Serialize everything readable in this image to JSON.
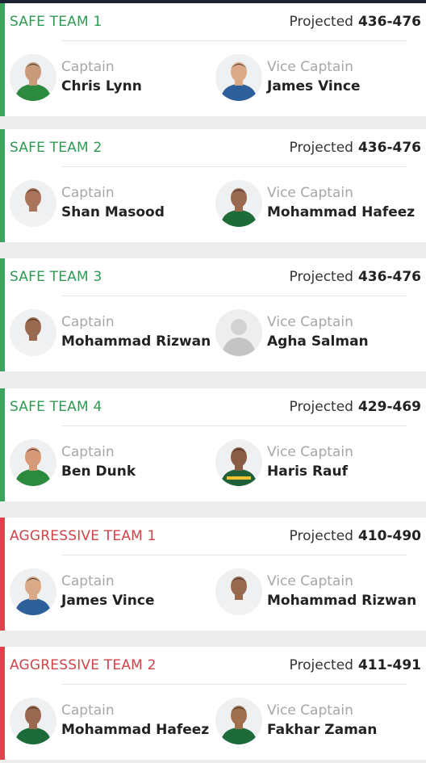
{
  "colors": {
    "safe": "#3da35d",
    "aggressive": "#d8474b",
    "background": "#ececec"
  },
  "teams": [
    {
      "type": "safe",
      "name": "SAFE TEAM 1",
      "projected_label": "Projected",
      "projected_range": "436-476",
      "captain": {
        "role": "Captain",
        "name": "Chris Lynn",
        "jersey": "#2b8a3e",
        "skin": "#c89a7a"
      },
      "vice": {
        "role": "Vice Captain",
        "name": "James Vince",
        "jersey": "#2d5f9a",
        "skin": "#d9a988"
      }
    },
    {
      "type": "safe",
      "name": "SAFE TEAM 2",
      "projected_label": "Projected",
      "projected_range": "436-476",
      "captain": {
        "role": "Captain",
        "name": "Shan Masood",
        "jersey": "#f2f2f2",
        "skin": "#a9745a"
      },
      "vice": {
        "role": "Vice Captain",
        "name": "Mohammad Hafeez",
        "jersey": "#1e6b3a",
        "skin": "#9a6a50"
      }
    },
    {
      "type": "safe",
      "name": "SAFE TEAM 3",
      "projected_label": "Projected",
      "projected_range": "436-476",
      "captain": {
        "role": "Captain",
        "name": "Mohammad Rizwan",
        "jersey": "#f2f2f2",
        "skin": "#9a6a50"
      },
      "vice": {
        "role": "Vice Captain",
        "name": "Agha Salman",
        "jersey": "#bfbfbf",
        "skin": "#cfcfcf",
        "placeholder": true
      }
    },
    {
      "type": "safe",
      "name": "SAFE TEAM 4",
      "projected_label": "Projected",
      "projected_range": "429-469",
      "captain": {
        "role": "Captain",
        "name": "Ben Dunk",
        "jersey": "#2b8a3e",
        "skin": "#d79a78"
      },
      "vice": {
        "role": "Vice Captain",
        "name": "Haris Rauf",
        "jersey": "#1f5f3a",
        "skin": "#8a5c44",
        "accent": "#f2c230"
      }
    },
    {
      "type": "aggressive",
      "name": "AGGRESSIVE TEAM 1",
      "projected_label": "Projected",
      "projected_range": "410-490",
      "captain": {
        "role": "Captain",
        "name": "James Vince",
        "jersey": "#2d5f9a",
        "skin": "#d9a988"
      },
      "vice": {
        "role": "Vice Captain",
        "name": "Mohammad Rizwan",
        "jersey": "#f2f2f2",
        "skin": "#9a6a50"
      }
    },
    {
      "type": "aggressive",
      "name": "AGGRESSIVE TEAM 2",
      "projected_label": "Projected",
      "projected_range": "411-491",
      "captain": {
        "role": "Captain",
        "name": "Mohammad Hafeez",
        "jersey": "#1e6b3a",
        "skin": "#9a6a50"
      },
      "vice": {
        "role": "Vice Captain",
        "name": "Fakhar Zaman",
        "jersey": "#1e6b3a",
        "skin": "#a0704f"
      }
    }
  ]
}
